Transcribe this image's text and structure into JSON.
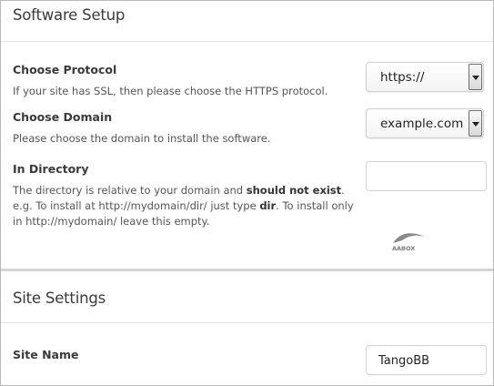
{
  "software_setup": {
    "title": "Software Setup",
    "protocol": {
      "label": "Choose Protocol",
      "help": "If your site has SSL, then please choose the HTTPS protocol.",
      "selected": "https://"
    },
    "domain": {
      "label": "Choose Domain",
      "help": "Please choose the domain to install the software.",
      "selected": "example.com"
    },
    "directory": {
      "label": "In Directory",
      "help_part1": "The directory is relative to your domain and ",
      "help_bold1": "should not exist",
      "help_part2": ". e.g. To install at http://mydomain/dir/ just type ",
      "help_bold2": "dir",
      "help_part3": ". To install only in http://mydomain/ leave this empty.",
      "value": ""
    },
    "logo_text": "AABOX"
  },
  "site_settings": {
    "title": "Site Settings",
    "site_name": {
      "label": "Site Name",
      "value": "TangoBB"
    }
  }
}
